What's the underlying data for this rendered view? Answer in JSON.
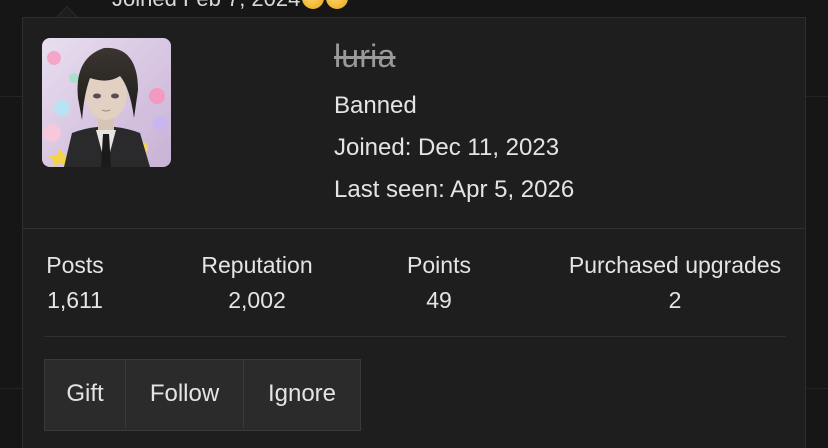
{
  "background": {
    "previous_line_text": "Joined Feb 7, 2024",
    "emojis": [
      "laughing-emoji",
      "laughing-emoji"
    ]
  },
  "profile": {
    "username": "luria",
    "username_struck": true,
    "status": "Banned",
    "joined": "Joined: Dec 11, 2023",
    "last_seen": "Last seen: Apr 5, 2026",
    "avatar_icon": "anime-avatar-image"
  },
  "stats": [
    {
      "label": "Posts",
      "value": "1,611"
    },
    {
      "label": "Reputation",
      "value": "2,002"
    },
    {
      "label": "Points",
      "value": "49"
    },
    {
      "label": "Purchased upgrades",
      "value": "2"
    }
  ],
  "actions": [
    {
      "label": "Gift"
    },
    {
      "label": "Follow"
    },
    {
      "label": "Ignore"
    }
  ],
  "colors": {
    "background": "#161616",
    "card": "#1e1e1e",
    "button": "#2b2b2b",
    "text": "#e4e4e4",
    "muted_username": "#9a9a9a"
  }
}
